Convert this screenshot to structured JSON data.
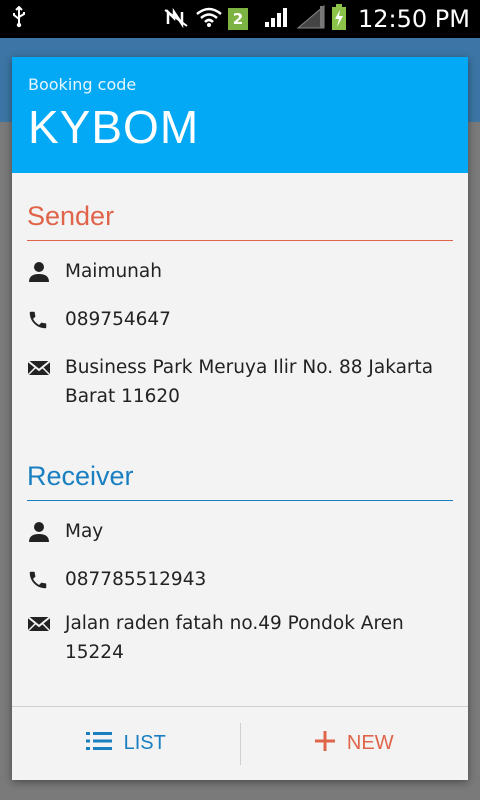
{
  "status_bar": {
    "time": "12:50 PM",
    "sim_badge": "2"
  },
  "dialog": {
    "caption": "Booking code",
    "code": "KYBOM"
  },
  "sender": {
    "title": "Sender",
    "name": "Maimunah",
    "phone": "089754647",
    "address": "Business Park Meruya Ilir No. 88 Jakarta Barat 11620"
  },
  "receiver": {
    "title": "Receiver",
    "name": "May",
    "phone": "087785512943",
    "address": "Jalan raden fatah no.49 Pondok Aren 15224"
  },
  "footer": {
    "list_label": "LIST",
    "new_label": "NEW"
  },
  "colors": {
    "header": "#03a9f4",
    "sender_accent": "#e0644a",
    "receiver_accent": "#1a7fc1"
  }
}
